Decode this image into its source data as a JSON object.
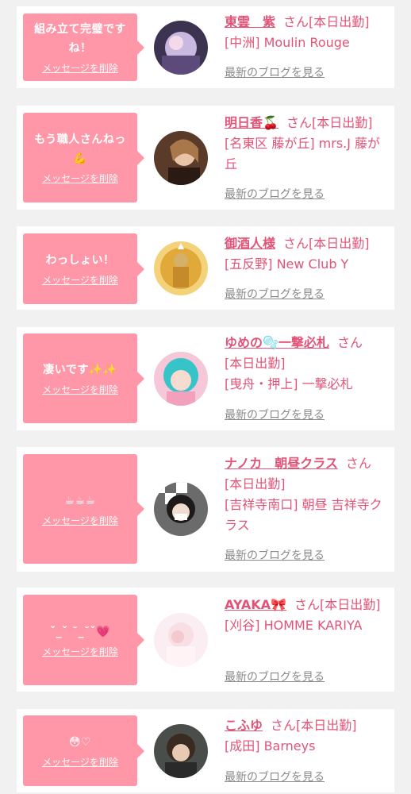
{
  "delete_label": "メッセージを削除",
  "blog_label": "最新のブログを見る",
  "cards": [
    {
      "message": "組み立て完璧ですね！",
      "name": "東雲　紫",
      "honorific": "さん",
      "status": "[本日出勤]",
      "shop": "[中洲] Moulin Rouge"
    },
    {
      "message": "もう職人さんねっ💪",
      "name": "明日香🍒",
      "honorific": "さん",
      "status": "[本日出勤]",
      "shop": "[名東区 藤が丘] mrs.J 藤が丘"
    },
    {
      "message": "わっしょい！",
      "name": "御酒人様",
      "honorific": "さん",
      "status": "[本日出勤]",
      "shop": "[五反野] New Club Y"
    },
    {
      "message": "凄いです✨✨",
      "name": "ゆめの🫧一撃必札",
      "honorific": "さん",
      "status": "[本日出勤]",
      "shop": "[曳舟・押上] 一撃必札"
    },
    {
      "message": "☕☕☕",
      "name": "ナノカ　朝昼クラス",
      "honorific": "さん",
      "status": "[本日出勤]",
      "shop": "[吉祥寺南口] 朝昼 吉祥寺クラス"
    },
    {
      "message": "ˇ_ˇ ˘_˘ˇ💗",
      "name": "AYAKA🎀",
      "honorific": "さん",
      "status": "[本日出勤]",
      "shop": "[刈谷] HOMME KARIYA"
    },
    {
      "message": "😳♡",
      "name": "こふゆ",
      "honorific": "さん",
      "status": "[本日出勤]",
      "shop": "[成田] Barneys"
    }
  ],
  "colors": {
    "accent": "#e25477",
    "bubble": "#ff97a8",
    "background": "#f1f1f1"
  }
}
